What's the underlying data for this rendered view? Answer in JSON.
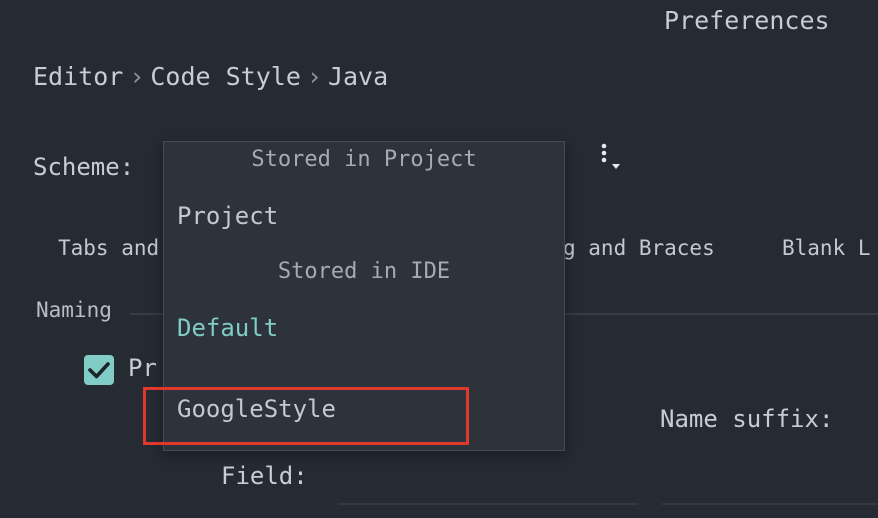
{
  "window": {
    "title": "Preferences"
  },
  "breadcrumb": {
    "items": [
      "Editor",
      "Code Style",
      "Java"
    ],
    "separator": "›"
  },
  "scheme": {
    "label": "Scheme:",
    "menu_icon": "kebab-dropdown-icon"
  },
  "tabs": {
    "tabs_and": "Tabs and",
    "wrapping": "g and Braces",
    "blank": "Blank L"
  },
  "naming": {
    "section_label": "Naming"
  },
  "options": {
    "prefer_checkbox_label": "Pr",
    "prefer_checked": true,
    "name_suffix_label": "Name suffix:",
    "field_label": "Field:"
  },
  "dropdown": {
    "group_project": "Stored in Project",
    "item_project": "Project",
    "group_ide": "Stored in IDE",
    "item_default": "Default",
    "item_google": "GoogleStyle"
  },
  "colors": {
    "background": "#262a33",
    "popup_background": "#2e323b",
    "accent_teal": "#7fcdc6",
    "highlight_red": "#e0392b"
  }
}
